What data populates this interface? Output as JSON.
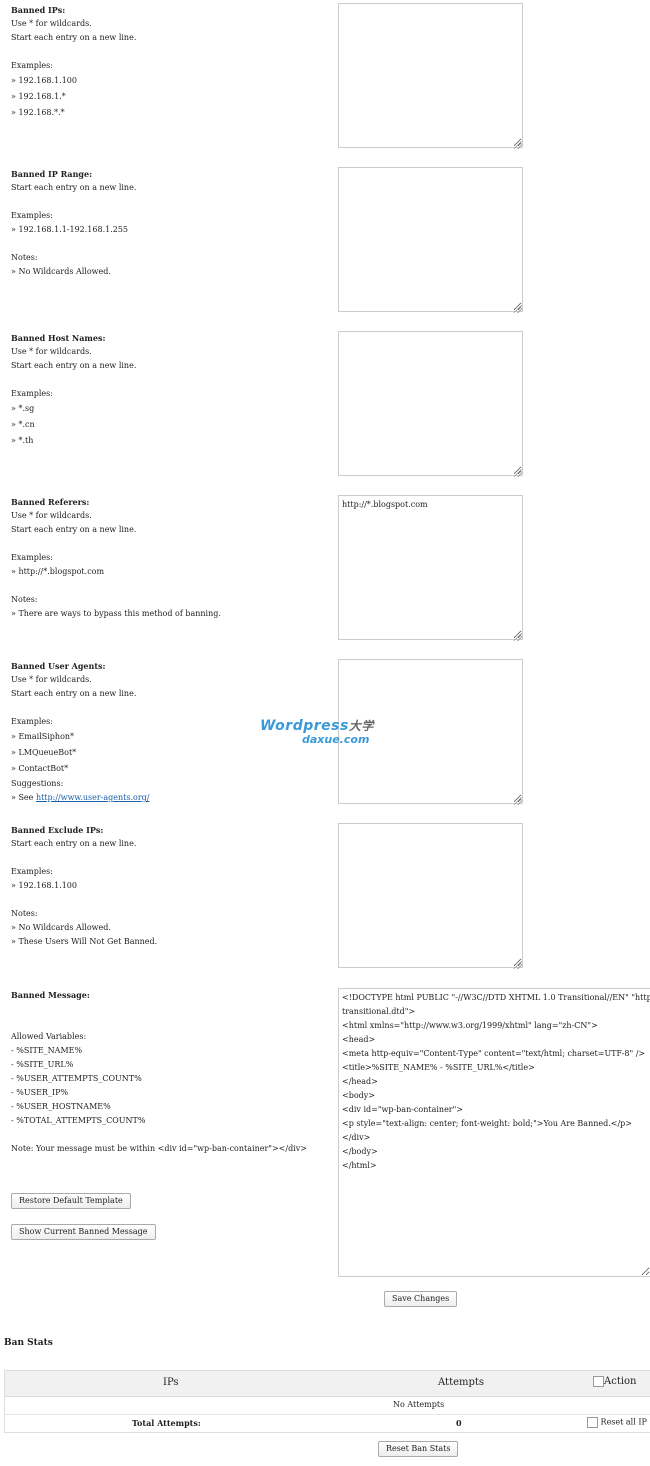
{
  "sections": [
    {
      "heading": "Banned IPs:",
      "lines": [
        "Use * for wildcards.",
        "Start each entry on a new line.",
        "",
        "Examples:",
        "» 192.168.1.100",
        "» 192.168.1.*",
        "» 192.168.*.*"
      ],
      "value": ""
    },
    {
      "heading": "Banned IP Range:",
      "lines": [
        "Start each entry on a new line.",
        "",
        "Examples:",
        "» 192.168.1.1-192.168.1.255",
        "",
        "Notes:",
        "» No Wildcards Allowed."
      ],
      "value": ""
    },
    {
      "heading": "Banned Host Names:",
      "lines": [
        "Use * for wildcards.",
        "Start each entry on a new line.",
        "",
        "Examples:",
        "» *.sg",
        "» *.cn",
        "» *.th"
      ],
      "value": ""
    },
    {
      "heading": "Banned Referers:",
      "lines": [
        "Use * for wildcards.",
        "Start each entry on a new line.",
        "",
        "Examples:",
        "» http://*.blogspot.com",
        "",
        "Notes:",
        "» There are ways to bypass this method of banning."
      ],
      "value": "http://*.blogspot.com"
    },
    {
      "heading": "Banned User Agents:",
      "lines": [
        "Use * for wildcards.",
        "Start each entry on a new line.",
        "",
        "Examples:",
        "» EmailSiphon*",
        "» LMQueueBot*",
        "» ContactBot*",
        "Suggestions:"
      ],
      "suggestion_prefix": "» See ",
      "suggestion_link": "http://www.user-agents.org/",
      "value": ""
    },
    {
      "heading": "Banned Exclude IPs:",
      "lines": [
        "Start each entry on a new line.",
        "",
        "Examples:",
        "» 192.168.1.100",
        "",
        "Notes:",
        "» No Wildcards Allowed.",
        "» These Users Will Not Get Banned."
      ],
      "value": ""
    }
  ],
  "message": {
    "heading": "Banned Message:",
    "variables_label": "Allowed Variables:",
    "variables": [
      "- %SITE_NAME%",
      "- %SITE_URL%",
      "- %USER_ATTEMPTS_COUNT%",
      "- %USER_IP%",
      "- %USER_HOSTNAME%",
      "- %TOTAL_ATTEMPTS_COUNT%"
    ],
    "note": "Note: Your message must be within <div id=\"wp-ban-container\"></div>",
    "restore_button": "Restore Default Template",
    "show_button": "Show Current Banned Message",
    "template": "<!DOCTYPE html PUBLIC \"-//W3C//DTD XHTML 1.0 Transitional//EN\" \"http://www.w3.org/TR/xhtml1/DTD/xhtml1-\ntransitional.dtd\">\n<html xmlns=\"http://www.w3.org/1999/xhtml\" lang=\"zh-CN\">\n<head>\n<meta http-equiv=\"Content-Type\" content=\"text/html; charset=UTF-8\" />\n<title>%SITE_NAME% - %SITE_URL%</title>\n</head>\n<body>\n<div id=\"wp-ban-container\">\n<p style=\"text-align: center; font-weight: bold;\">You Are Banned.</p>\n</div>\n</body>\n</html>"
  },
  "save_button": "Save Changes",
  "stats": {
    "title": "Ban Stats",
    "col_ips": "IPs",
    "col_attempts": "Attempts",
    "col_action": "Action",
    "no_attempts": "No Attempts",
    "total_label": "Total Attempts:",
    "total_value": "0",
    "reset_all": "Reset all IP",
    "reset_button": "Reset Ban Stats"
  },
  "watermark": {
    "line1": "Wordpress",
    "cn": "大学",
    "line2": "daxue.com"
  },
  "colors": {
    "link": "#1a5fa8",
    "watermark": "#3a9ad9"
  }
}
